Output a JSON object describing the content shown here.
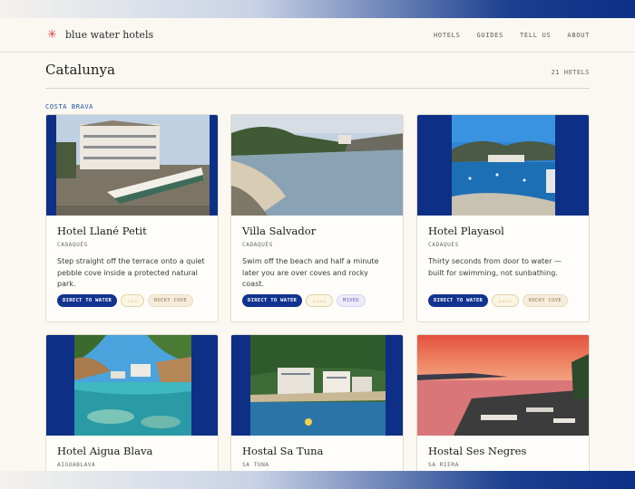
{
  "header": {
    "brand": "blue water hotels",
    "nav": [
      "HOTELS",
      "GUIDES",
      "TELL US",
      "ABOUT"
    ]
  },
  "page": {
    "title": "Catalunya",
    "count": "21 HOTELS",
    "section": "COSTA BRAVA"
  },
  "hotels": [
    {
      "name": "Hotel Llané Petit",
      "place": "CADAQUÉS",
      "description": "Step straight off the terrace onto a quiet pebble cove inside a protected natural park.",
      "tags": [
        "DIRECT TO WATER",
        "☆☆☆",
        "ROCKY COVE"
      ]
    },
    {
      "name": "Villa Salvador",
      "place": "CADAQUÉS",
      "description": "Swim off the beach and half a minute later you are over coves and rocky coast.",
      "tags": [
        "DIRECT TO WATER",
        "☆☆☆☆",
        "MIXED"
      ]
    },
    {
      "name": "Hotel Playasol",
      "place": "CADAQUÉS",
      "description": "Thirty seconds from door to water — built for swimming, not sunbathing.",
      "tags": [
        "DIRECT TO WATER",
        "☆☆☆☆",
        "ROCKY COVE"
      ]
    },
    {
      "name": "Hotel Aigua Blava",
      "place": "AIGUABLAVA"
    },
    {
      "name": "Hostal Sa Tuna",
      "place": "SA TUNA"
    },
    {
      "name": "Hostal Ses Negres",
      "place": "SA RIERA"
    }
  ],
  "colors": {
    "accent_blue": "#12338f",
    "logo_red": "#d9463a",
    "section_blue": "#1f4fa8"
  }
}
